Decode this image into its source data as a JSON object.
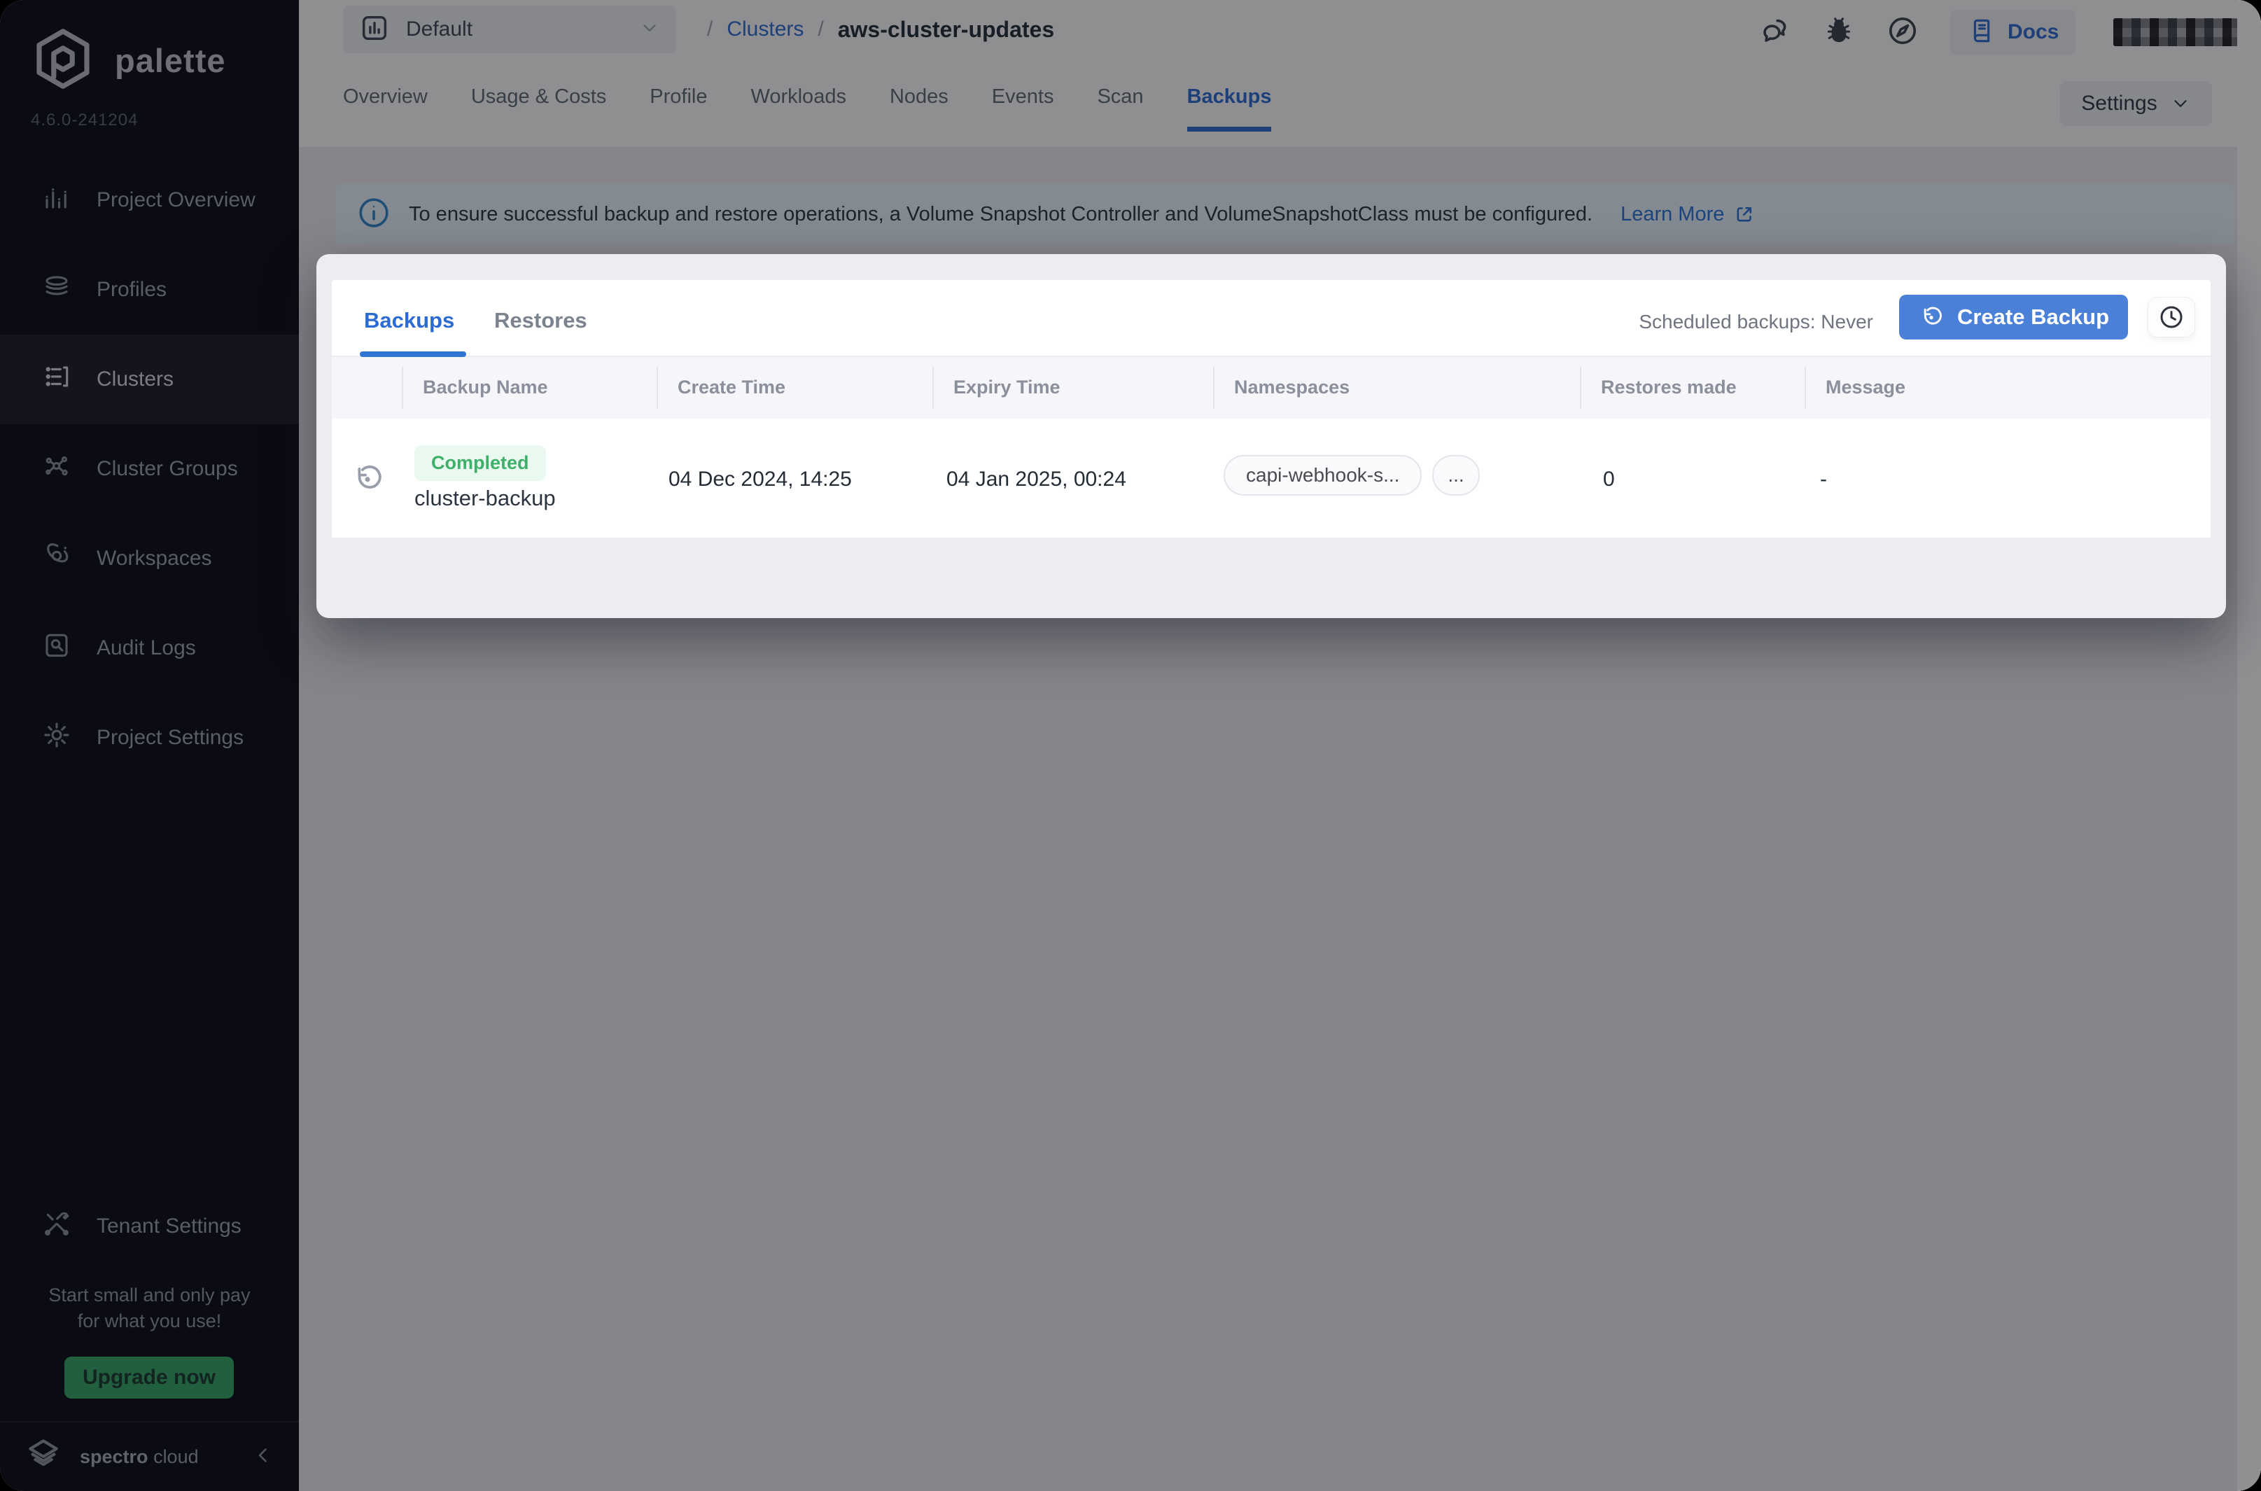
{
  "sidebar": {
    "logo_text": "palette",
    "version": "4.6.0-241204",
    "items": [
      {
        "label": "Project Overview"
      },
      {
        "label": "Profiles"
      },
      {
        "label": "Clusters"
      },
      {
        "label": "Cluster Groups"
      },
      {
        "label": "Workspaces"
      },
      {
        "label": "Audit Logs"
      },
      {
        "label": "Project Settings"
      }
    ],
    "tenant_settings_label": "Tenant Settings",
    "promo_line1": "Start small and only pay",
    "promo_line2": "for what you use!",
    "upgrade_label": "Upgrade now",
    "brand_primary": "spectro",
    "brand_secondary": "cloud"
  },
  "topbar": {
    "project_selector_value": "Default",
    "breadcrumb": {
      "sep": "/",
      "link": "Clusters",
      "current": "aws-cluster-updates"
    },
    "docs_label": "Docs"
  },
  "tabs": {
    "items": [
      "Overview",
      "Usage & Costs",
      "Profile",
      "Workloads",
      "Nodes",
      "Events",
      "Scan",
      "Backups"
    ],
    "active": "Backups"
  },
  "settings_button_label": "Settings",
  "banner": {
    "text": "To ensure successful backup and restore operations, a Volume Snapshot Controller and VolumeSnapshotClass must be configured.",
    "link_label": "Learn More"
  },
  "card": {
    "tabs": {
      "backups": "Backups",
      "restores": "Restores"
    },
    "scheduled_label": "Scheduled backups: Never",
    "create_button_label": "Create Backup",
    "table": {
      "headers": [
        "Backup Name",
        "Create Time",
        "Expiry Time",
        "Namespaces",
        "Restores made",
        "Message"
      ],
      "row": {
        "status": "Completed",
        "name": "cluster-backup",
        "create_time": "04 Dec 2024, 14:25",
        "expiry_time": "04 Jan 2025, 00:24",
        "namespace_chip": "capi-webhook-s...",
        "more_chip": "...",
        "restores_made": "0",
        "message": "-"
      }
    }
  },
  "colors": {
    "accent_blue": "#2c6bd2",
    "button_blue": "#4a80d8",
    "success_green": "#3fb06a",
    "success_bg": "#eaf9f0",
    "upgrade_green": "#35a567",
    "banner_bg": "#e7f2fb",
    "sidebar_bg": "#0b0b16"
  }
}
